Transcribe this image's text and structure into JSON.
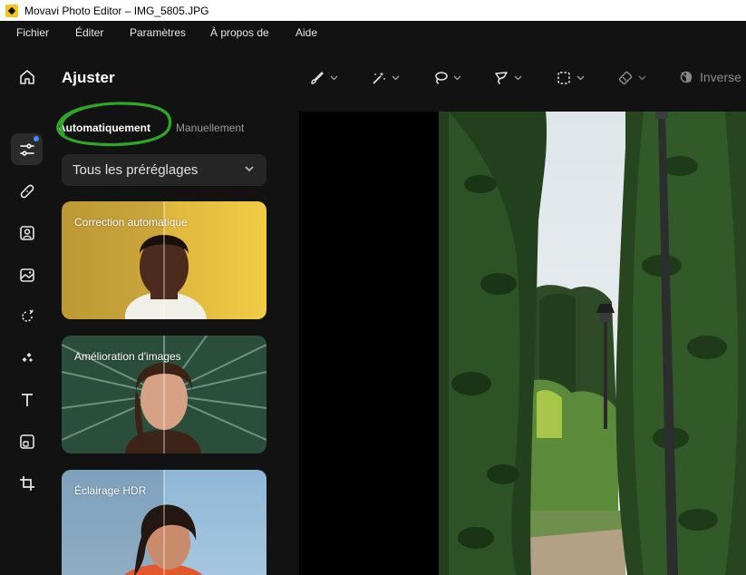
{
  "window": {
    "title": "Movavi Photo Editor – IMG_5805.JPG"
  },
  "menu": [
    "Fichier",
    "Éditer",
    "Paramètres",
    "À propos de",
    "Aide"
  ],
  "sidebar": {
    "items": [
      "home-icon",
      "adjust-icon",
      "retouch-icon",
      "portrait-icon",
      "replace-background-icon",
      "object-removal-icon",
      "effects-icon",
      "text-icon",
      "frames-icon",
      "crop-icon"
    ]
  },
  "panel": {
    "title": "Ajuster",
    "tabs": {
      "auto": "Automatiquement",
      "manual": "Manuellement"
    },
    "presets_select": "Tous les préréglages",
    "cards": [
      "Correction automatique",
      "Amélioration d'images",
      "Éclairage HDR"
    ]
  },
  "toolbar": {
    "tools": [
      "brush-icon",
      "magic-wand-icon",
      "lasso-icon",
      "polygon-lasso-icon",
      "rect-select-icon",
      "eraser-icon"
    ],
    "inverse_label": "Inverse"
  },
  "colors": {
    "accent": "#3b8dff",
    "annotation": "#2fa52a",
    "panel_bg": "#121212",
    "control_bg": "#262626"
  }
}
